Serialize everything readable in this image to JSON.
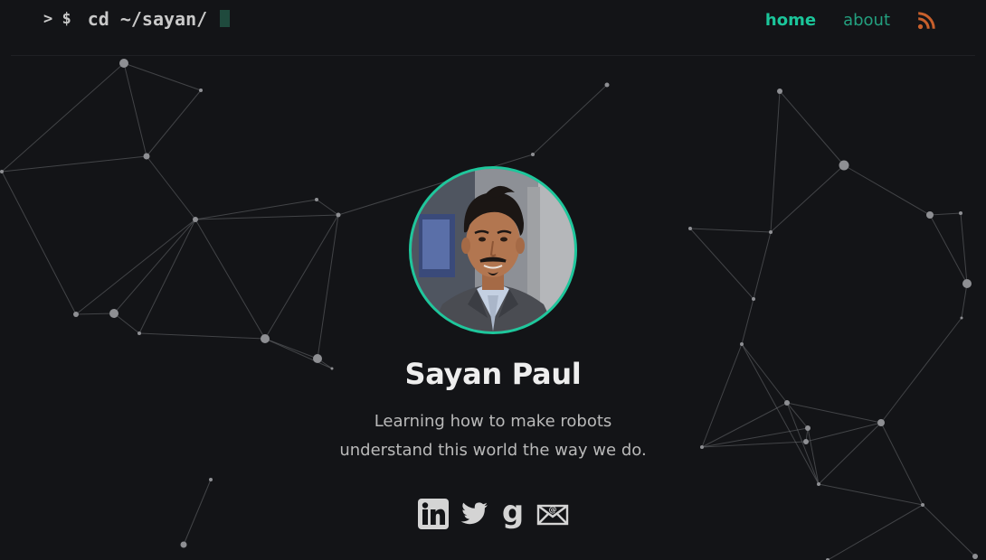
{
  "header": {
    "prompt_symbol": "> $",
    "command": "cd ~/sayan/"
  },
  "nav": {
    "items": [
      {
        "label": "home",
        "active": true
      },
      {
        "label": "about",
        "active": false
      }
    ],
    "rss_icon": "rss-icon"
  },
  "profile": {
    "name": "Sayan Paul",
    "tagline_line1": "Learning how to make robots",
    "tagline_line2": "understand this world the way we do."
  },
  "socials": [
    {
      "icon": "linkedin-icon"
    },
    {
      "icon": "twitter-icon"
    },
    {
      "icon": "goodreads-icon"
    },
    {
      "icon": "email-icon"
    }
  ],
  "colors": {
    "background": "#131417",
    "accent": "#1bc59a",
    "accent_dim": "#23a07f",
    "rss": "#c8602c",
    "icon": "#d4d4d4",
    "network": "#6a6b6f"
  }
}
